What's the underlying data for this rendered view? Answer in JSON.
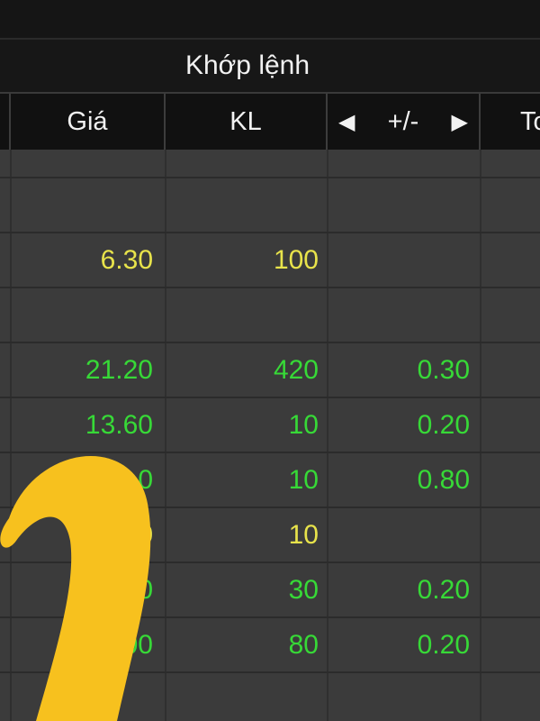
{
  "header": {
    "group_title": "Khớp lệnh",
    "columns": {
      "price": "Giá",
      "volume": "KL",
      "change": "+/-",
      "next_partial": "To",
      "left_arrow": "◀",
      "right_arrow": "▶"
    }
  },
  "rows": [
    {
      "price": "",
      "volume": "",
      "change": "",
      "color": ""
    },
    {
      "price": "6.30",
      "volume": "100",
      "change": "",
      "color": "yellow"
    },
    {
      "price": "",
      "volume": "",
      "change": "",
      "color": ""
    },
    {
      "price": "21.20",
      "volume": "420",
      "change": "0.30",
      "color": "green"
    },
    {
      "price": "13.60",
      "volume": "10",
      "change": "0.20",
      "color": "green"
    },
    {
      "price": "0",
      "volume": "10",
      "change": "0.80",
      "color": "green"
    },
    {
      "price": "0",
      "volume": "10",
      "change": "",
      "color": "yellow"
    },
    {
      "price": "0",
      "volume": "30",
      "change": "0.20",
      "color": "green"
    },
    {
      "price": "00",
      "volume": "80",
      "change": "0.20",
      "color": "green"
    }
  ],
  "colors": {
    "yellow": "#e8e34b",
    "green": "#37d937",
    "overlay_yellow": "#f7c11e"
  }
}
